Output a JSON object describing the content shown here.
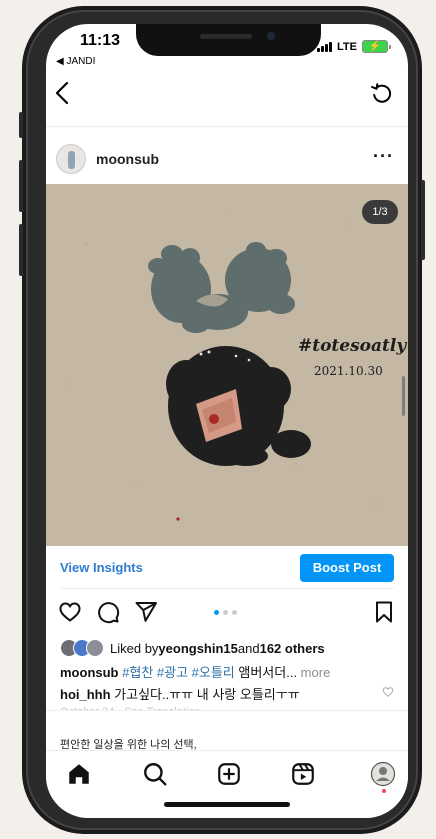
{
  "status_bar": {
    "time": "11:13",
    "carrier_back": "◀ JANDI",
    "network": "LTE",
    "battery_color": "#3fd24b"
  },
  "post": {
    "username": "moonsub",
    "image": {
      "page_counter": "1/3",
      "hashtag": "#totesoatly",
      "date": "2021.10.30"
    },
    "view_insights_label": "View Insights",
    "boost_label": "Boost Post",
    "carousel_active_index": 0,
    "carousel_count": 3,
    "likes": {
      "prefix": "Liked by ",
      "user": "yeongshin15",
      "middle": " and ",
      "others": "162 others"
    },
    "caption": {
      "user": "moonsub",
      "tags": "#협찬 #광고 #오틀리",
      "text": " 앰버서더...",
      "more": " more"
    },
    "comment": {
      "user": "hoi_hhh",
      "text": " 가고싶다..ㅠㅠ 내 사랑 오틀리ㅜㅠ"
    },
    "faded_line": "October 24 · See Translation",
    "promo_text": "편안한 일상을 위한 나의 선택,"
  },
  "icons": {
    "back": "chevron-left-icon",
    "refresh": "refresh-icon",
    "more": "more-horizontal-icon",
    "like": "heart-icon",
    "comment": "comment-icon",
    "share": "send-icon",
    "save": "bookmark-icon",
    "home": "home-icon",
    "search": "search-icon",
    "new_post": "plus-square-icon",
    "reels": "reels-icon",
    "profile": "profile-icon"
  },
  "colors": {
    "link_blue": "#2f7cd0",
    "boost_bg": "#0095f6",
    "tag_blue": "#2e6fa8",
    "notification_dot": "#ed4956"
  }
}
